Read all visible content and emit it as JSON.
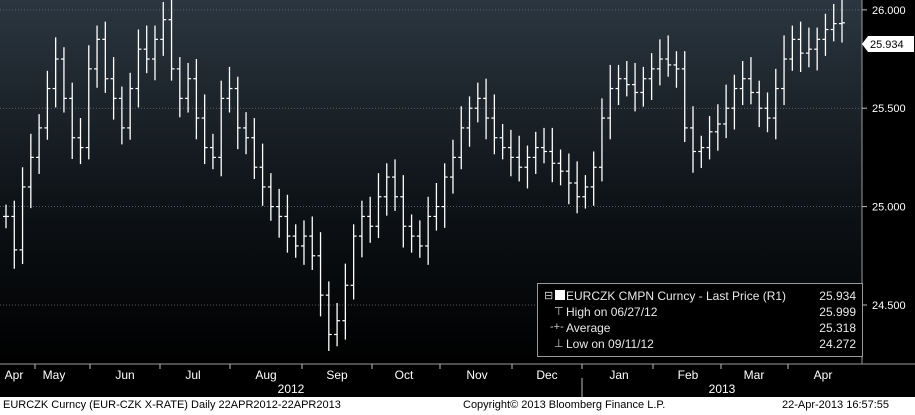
{
  "chart_data": {
    "type": "bar",
    "ylim": [
      24.2,
      26.05
    ],
    "y_ticks": [
      24.5,
      25.0,
      25.5,
      26.0
    ],
    "y_tick_labels": [
      "24.500",
      "25.000",
      "25.500",
      "26.000"
    ],
    "last_price_label": "25.934",
    "last_price": 25.934,
    "month_labels": [
      "Apr",
      "May",
      "Jun",
      "Jul",
      "Aug",
      "Sep",
      "Oct",
      "Nov",
      "Dec",
      "Jan",
      "Feb",
      "Mar",
      "Apr"
    ],
    "year_labels": [
      "2012",
      "2013"
    ],
    "grid": true,
    "legend_position": "bottom-right",
    "series": [
      {
        "name": "EURCZK CMPN Curncy - Last Price (R1)",
        "values": [
          24.95,
          24.78,
          25.1,
          25.25,
          25.4,
          25.6,
          25.75,
          25.55,
          25.35,
          25.3,
          25.7,
          25.85,
          25.65,
          25.55,
          25.4,
          25.6,
          25.8,
          25.75,
          25.85,
          25.95,
          25.7,
          25.55,
          25.65,
          25.45,
          25.3,
          25.25,
          25.55,
          25.6,
          25.4,
          25.35,
          25.2,
          25.1,
          25.0,
          24.95,
          24.85,
          24.8,
          24.85,
          24.75,
          24.55,
          24.35,
          24.42,
          24.6,
          24.85,
          24.95,
          24.9,
          25.05,
          25.15,
          25.05,
          24.9,
          24.85,
          24.8,
          24.95,
          25.0,
          25.15,
          25.25,
          25.4,
          25.5,
          25.55,
          25.45,
          25.35,
          25.3,
          25.25,
          25.2,
          25.25,
          25.3,
          25.28,
          25.22,
          25.18,
          25.12,
          25.05,
          25.1,
          25.2,
          25.45,
          25.6,
          25.65,
          25.62,
          25.58,
          25.65,
          25.7,
          25.75,
          25.72,
          25.7,
          25.4,
          25.28,
          25.3,
          25.38,
          25.42,
          25.5,
          25.6,
          25.65,
          25.58,
          25.5,
          25.45,
          25.6,
          25.75,
          25.85,
          25.78,
          25.8,
          25.85,
          25.9,
          25.93,
          25.934
        ]
      }
    ],
    "legend": {
      "title": "EURCZK CMPN Curncy - Last Price (R1)",
      "title_value": "25.934",
      "high_label": "High on 06/27/12",
      "high_value": "25.999",
      "avg_label": "Average",
      "avg_value": "25.318",
      "low_label": "Low on 09/11/12",
      "low_value": "24.272"
    }
  },
  "footer": {
    "ticker": "EURCZK Curncy (EUR-CZK X-RATE)  Daily 22APR2012-22APR2013",
    "copyright": "Copyright© 2013 Bloomberg Finance L.P.",
    "timestamp": "22-Apr-2013  16:57:55"
  },
  "colors": {
    "bar": "#ffffff",
    "grid": "#6a7480",
    "bg_top": "#2b3640",
    "bg_bottom": "#000000"
  }
}
